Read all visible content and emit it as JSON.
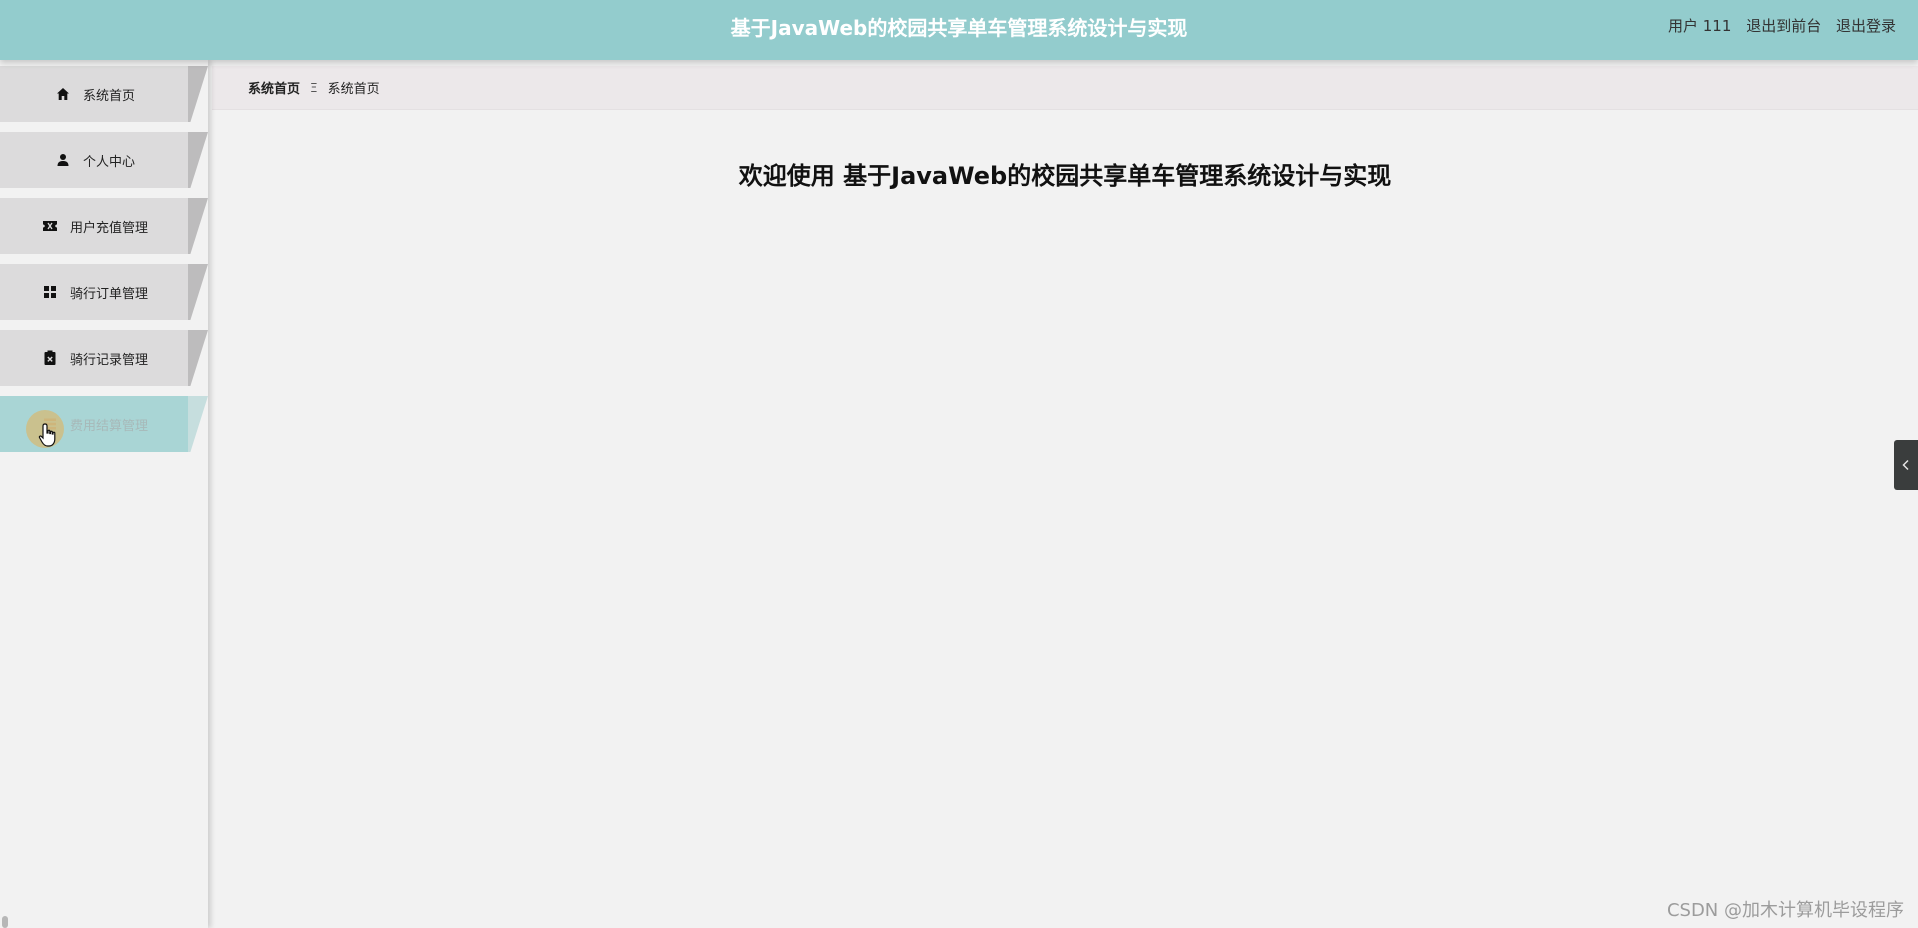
{
  "header": {
    "title": "基于JavaWeb的校园共享单车管理系统设计与实现",
    "user_label": "用户 111",
    "back_to_front": "退出到前台",
    "logout": "退出登录",
    "bg_color": "#93cccd"
  },
  "sidebar": {
    "items": [
      {
        "label": "系统首页",
        "icon": "home-icon"
      },
      {
        "label": "个人中心",
        "icon": "person-icon"
      },
      {
        "label": "用户充值管理",
        "icon": "ticket-icon"
      },
      {
        "label": "骑行订单管理",
        "icon": "grid-icon"
      },
      {
        "label": "骑行记录管理",
        "icon": "clipboard-x-icon"
      },
      {
        "label": "费用结算管理",
        "icon": "list-icon",
        "active": true
      }
    ],
    "item_color": "#dcdbdc",
    "active_color": "#a9d5d5"
  },
  "breadcrumb": {
    "first": "系统首页",
    "separator": "Ξ",
    "second": "系统首页"
  },
  "main": {
    "welcome": "欢迎使用 基于JavaWeb的校园共享单车管理系统设计与实现"
  },
  "watermark": "CSDN @加木计算机毕设程序"
}
